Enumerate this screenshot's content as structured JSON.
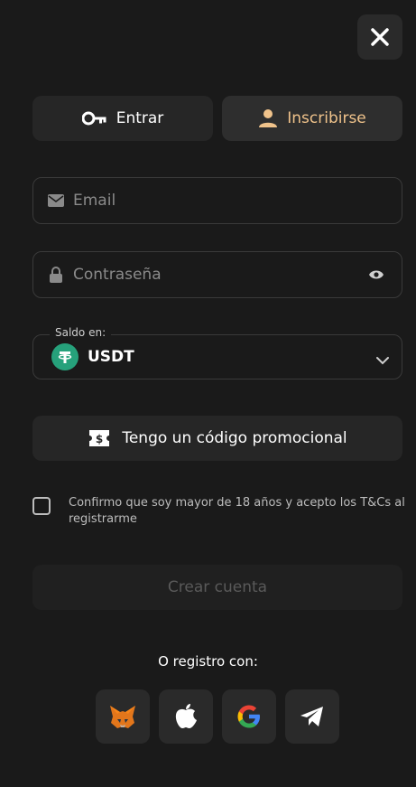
{
  "tabs": [
    {
      "label": "Entrar",
      "icon": "key-icon",
      "active": false
    },
    {
      "label": "Inscribirse",
      "icon": "user-icon",
      "active": true
    }
  ],
  "form": {
    "email": {
      "placeholder": "Email",
      "value": ""
    },
    "password": {
      "placeholder": "Contraseña",
      "value": ""
    },
    "currency": {
      "legend": "Saldo en:",
      "value": "USDT",
      "icon": "tether-icon"
    },
    "promo_label": "Tengo un código promocional",
    "terms_text": "Confirmo que soy mayor de 18 años y acepto los T&Cs al registrarme",
    "terms_checked": false,
    "submit_label": "Crear cuenta"
  },
  "social": {
    "title": "O registro con:",
    "providers": [
      "metamask-icon",
      "apple-icon",
      "google-icon",
      "telegram-icon"
    ]
  },
  "colors": {
    "background": "#1a1a1a",
    "accent": "#f0c38b",
    "tether": "#26a17b"
  }
}
